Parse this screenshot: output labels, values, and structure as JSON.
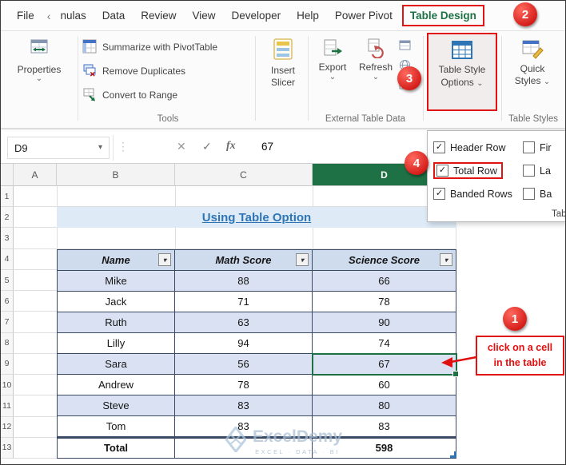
{
  "icons": {
    "caret_down": "⌄",
    "name_box_arrow": "▾",
    "cancel": "✕",
    "enter": "✓",
    "filter_arrow": "▾",
    "check": "✓",
    "chevron_left": "‹",
    "grip_dots": "⋮"
  },
  "tabs": {
    "items": [
      "File",
      "nulas",
      "Data",
      "Review",
      "View",
      "Developer",
      "Help",
      "Power Pivot",
      "Table Design"
    ]
  },
  "ribbon": {
    "properties": "Properties",
    "summarize_with_pivottable": "Summarize with PivotTable",
    "remove_duplicates": "Remove Duplicates",
    "convert_to_range": "Convert to Range",
    "insert_slicer": {
      "line1": "Insert",
      "line2": "Slicer"
    },
    "export": "Export",
    "refresh": "Refresh",
    "table_style_options": {
      "line1": "Table Style",
      "line2": "Options"
    },
    "quick_styles": {
      "line1": "Quick",
      "line2": "Styles"
    },
    "groups": {
      "tools": "Tools",
      "external_table_data": "External Table Data",
      "table_styles": "Table Styles"
    }
  },
  "style_options_panel": {
    "options": [
      {
        "label": "Header Row",
        "checked": true
      },
      {
        "label": "Fir",
        "checked": false
      },
      {
        "label": "Total Row",
        "checked": true
      },
      {
        "label": "La",
        "checked": false
      },
      {
        "label": "Banded Rows",
        "checked": true
      },
      {
        "label": "Ba",
        "checked": false
      }
    ],
    "footer": "Table"
  },
  "formula_bar": {
    "name_box": "D9",
    "fx": "fx",
    "value": "67"
  },
  "sheet": {
    "column_headers": [
      "A",
      "B",
      "C",
      "D"
    ],
    "row_numbers": [
      "1",
      "2",
      "3",
      "4",
      "5",
      "6",
      "7",
      "8",
      "9",
      "10",
      "11",
      "12",
      "13"
    ],
    "title": "Using Table Option",
    "table": {
      "headers": [
        "Name",
        "Math Score",
        "Science Score"
      ],
      "rows": [
        [
          "Mike",
          "88",
          "66"
        ],
        [
          "Jack",
          "71",
          "78"
        ],
        [
          "Ruth",
          "63",
          "90"
        ],
        [
          "Lilly",
          "94",
          "74"
        ],
        [
          "Sara",
          "56",
          "67"
        ],
        [
          "Andrew",
          "78",
          "60"
        ],
        [
          "Steve",
          "83",
          "80"
        ],
        [
          "Tom",
          "83",
          "83"
        ]
      ],
      "total": {
        "label": "Total",
        "math": "",
        "science": "598"
      }
    }
  },
  "annotations": {
    "steps": [
      "1",
      "2",
      "3",
      "4"
    ],
    "callout": {
      "line1": "click on a cell",
      "line2": "in the table"
    }
  },
  "watermark": {
    "name": "ExcelDemy",
    "tagline": "EXCEL · DATA · BI"
  },
  "colors": {
    "excel_green": "#1E7145",
    "annotation_red": "#E21313",
    "band_fill": "#D9E1F2",
    "header_fill": "#CFDCEE",
    "title_fill": "#DEEBF7",
    "title_text": "#2E75B6",
    "selected_column_header": "#1E7145"
  }
}
